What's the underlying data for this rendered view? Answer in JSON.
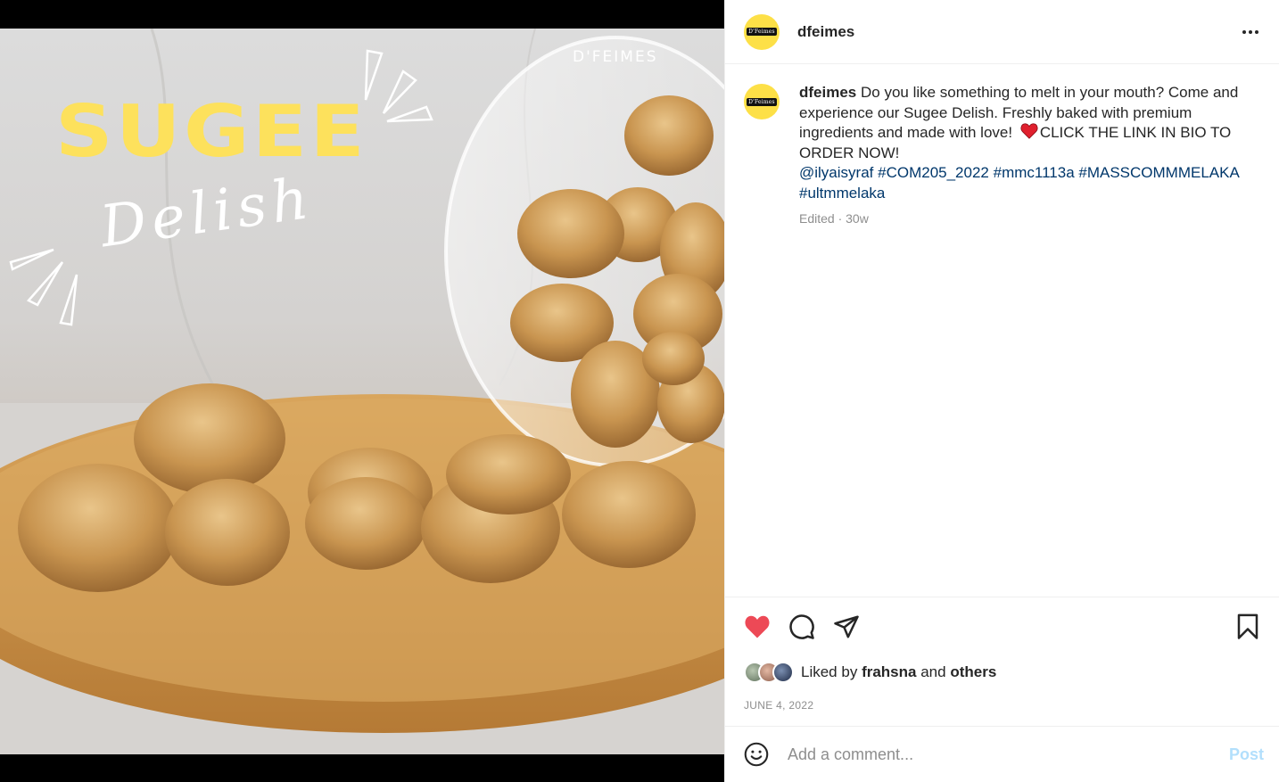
{
  "post_image": {
    "brand_text": "D'FEIMES",
    "title_text": "SUGEE",
    "script_text": "Delish",
    "title_color": "#fde15c"
  },
  "header": {
    "avatar_text": "D'Feimes",
    "username": "dfeimes",
    "more_icon": "more-horizontal-icon"
  },
  "caption": {
    "username": "dfeimes",
    "text": "Do you like something to melt in your mouth? Come and experience our Sugee Delish. Freshly baked with premium ingredients and made with love!",
    "emoji": "red-heart-icon",
    "text_after_emoji": "CLICK THE LINK IN BIO TO ORDER NOW!",
    "mention": "@ilyaisyraf",
    "hashtags": [
      "#COM205_2022",
      "#mmc1113a",
      "#MASSCOMMMELAKA",
      "#ultmmelaka"
    ],
    "meta": "Edited · 30w"
  },
  "actions": {
    "like_icon": "heart-filled-icon",
    "comment_icon": "comment-icon",
    "share_icon": "paper-plane-icon",
    "save_icon": "bookmark-icon",
    "liked": true,
    "like_color": "#ed4956"
  },
  "likes": {
    "prefix": "Liked by",
    "user": "frahsna",
    "conjunction": "and",
    "others": "others"
  },
  "date": "JUNE 4, 2022",
  "comment": {
    "placeholder": "Add a comment...",
    "post_label": "Post",
    "emoji_icon": "smiley-icon"
  },
  "colors": {
    "link": "#00376b",
    "muted": "#8e8e8e",
    "post_disabled": "#b2dffc"
  }
}
